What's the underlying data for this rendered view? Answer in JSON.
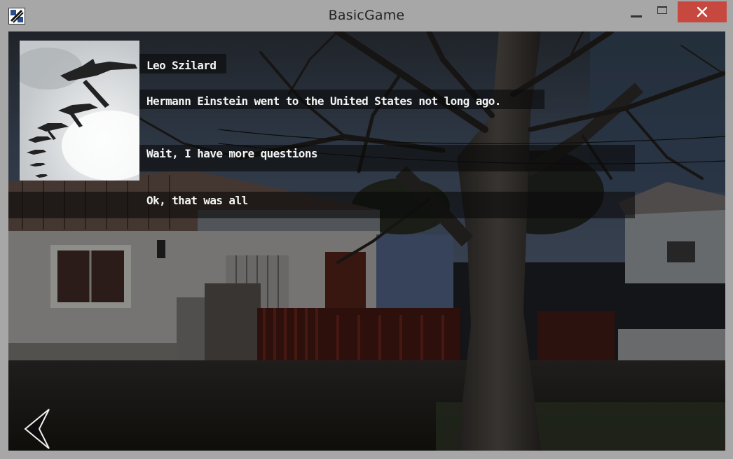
{
  "window": {
    "title": "BasicGame"
  },
  "dialogue": {
    "speaker": "Leo Szilard",
    "line": "Hermann Einstein went to the United States not long ago.",
    "options": [
      {
        "label": "Wait, I have more questions"
      },
      {
        "label": "Ok, that was all"
      }
    ]
  },
  "icons": {
    "app": "app-icon",
    "minimize": "minimize-icon",
    "maximize": "maximize-icon",
    "close": "close-icon",
    "back": "back-chevron-icon",
    "portrait": "bomber-planes-portrait"
  },
  "colors": {
    "close_button": "#c7483e",
    "dialog_text": "#f4f4f4"
  }
}
